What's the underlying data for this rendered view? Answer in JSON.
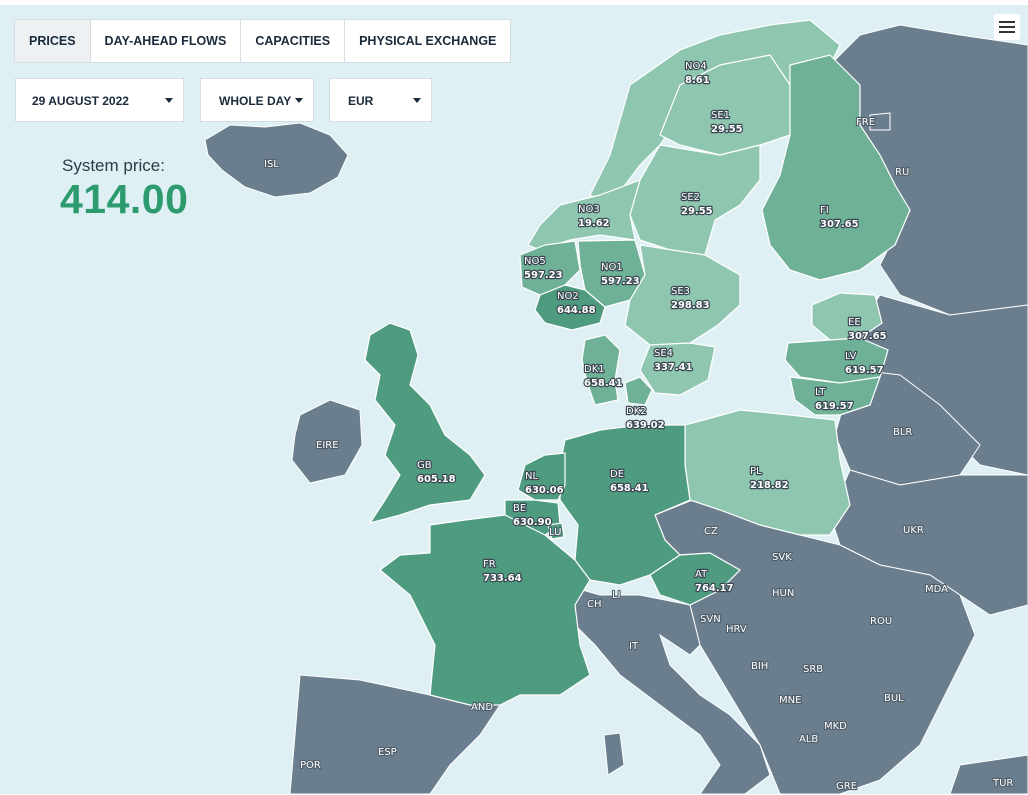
{
  "tabs": [
    {
      "label": "PRICES",
      "active": true
    },
    {
      "label": "DAY-AHEAD FLOWS",
      "active": false
    },
    {
      "label": "CAPACITIES",
      "active": false
    },
    {
      "label": "PHYSICAL EXCHANGE",
      "active": false
    }
  ],
  "filters": {
    "date": "29 AUGUST 2022",
    "period": "WHOLE DAY",
    "currency": "EUR"
  },
  "system_price": {
    "label": "System price:",
    "value": "414.00"
  },
  "menu_icon": "hamburger-menu-icon",
  "colors": {
    "sea": "#dff0f5",
    "land_other": "#6b7e8e",
    "accent": "#2e9b6f",
    "zone_dark": "#4f9b80",
    "zone_mid": "#6fb196",
    "zone_light": "#8ec6b0"
  },
  "price_zones": [
    {
      "code": "NO4",
      "price": "8.61"
    },
    {
      "code": "SE1",
      "price": "29.55"
    },
    {
      "code": "SE2",
      "price": "29.55"
    },
    {
      "code": "FI",
      "price": "307.65"
    },
    {
      "code": "NO3",
      "price": "19.62"
    },
    {
      "code": "NO5",
      "price": "597.23"
    },
    {
      "code": "NO1",
      "price": "597.23"
    },
    {
      "code": "NO2",
      "price": "644.88"
    },
    {
      "code": "SE3",
      "price": "298.83"
    },
    {
      "code": "SE4",
      "price": "337.41"
    },
    {
      "code": "EE",
      "price": "307.65"
    },
    {
      "code": "LV",
      "price": "619.57"
    },
    {
      "code": "LT",
      "price": "619.57"
    },
    {
      "code": "DK1",
      "price": "658.41"
    },
    {
      "code": "DK2",
      "price": "639.02"
    },
    {
      "code": "GB",
      "price": "605.18"
    },
    {
      "code": "NL",
      "price": "630.06"
    },
    {
      "code": "DE",
      "price": "658.41"
    },
    {
      "code": "PL",
      "price": "218.82"
    },
    {
      "code": "BE",
      "price": "630.90"
    },
    {
      "code": "FR",
      "price": "733.64"
    },
    {
      "code": "AT",
      "price": "764.17"
    }
  ],
  "countries": [
    "ISL",
    "FRE",
    "RU",
    "EIRE",
    "BLR",
    "UKR",
    "LU",
    "CZ",
    "SVK",
    "HUN",
    "MDA",
    "ROU",
    "CH",
    "LI",
    "SVN",
    "HRV",
    "IT",
    "BIH",
    "SRB",
    "MNE",
    "BUL",
    "MKD",
    "ALB",
    "AND",
    "ESP",
    "POR",
    "GRE",
    "TUR"
  ]
}
